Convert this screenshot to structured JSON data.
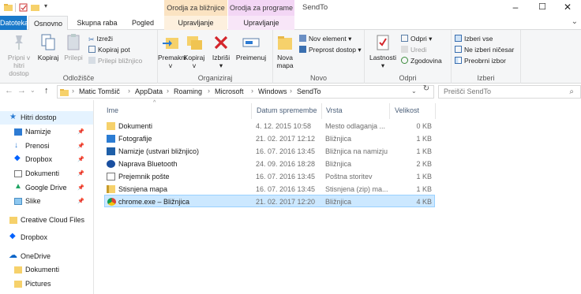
{
  "window": {
    "title": "SendTo",
    "context_tab_1": "Orodja za bližnjice",
    "context_tab_2": "Orodja za programe"
  },
  "ribbon_tabs": {
    "file": "Datoteka",
    "home": "Osnovno",
    "share": "Skupna raba",
    "view": "Pogled",
    "manage1": "Upravljanje",
    "manage2": "Upravljanje"
  },
  "ribbon": {
    "clipboard": {
      "label": "Odložišče",
      "pin": "Pripni v hitri\ndostop",
      "copy": "Kopiraj",
      "paste": "Prilepi",
      "cut": "Izreži",
      "copy_path": "Kopiraj pot",
      "paste_shortcut": "Prilepi bližnjico"
    },
    "organize": {
      "label": "Organiziraj",
      "move_to": "Premakni\nv",
      "copy_to": "Kopiraj\nv",
      "delete": "Izbriši",
      "rename": "Preimenuj"
    },
    "new": {
      "label": "Novo",
      "new_folder": "Nova\nmapa",
      "new_item": "Nov element",
      "easy_access": "Preprost dostop"
    },
    "open": {
      "label": "Odpri",
      "properties": "Lastnosti",
      "open": "Odpri",
      "edit": "Uredi",
      "history": "Zgodovina"
    },
    "select": {
      "label": "Izberi",
      "select_all": "Izberi vse",
      "select_none": "Ne izberi ničesar",
      "invert": "Preobrni izbor"
    }
  },
  "address": {
    "crumbs": [
      "Matic Tomšič",
      "AppData",
      "Roaming",
      "Microsoft",
      "Windows",
      "SendTo"
    ],
    "search_placeholder": "Preišči SendTo"
  },
  "nav": {
    "quick_access": "Hitri dostop",
    "pinned": [
      "Namizje",
      "Prenosi",
      "Dropbox",
      "Dokumenti",
      "Google Drive",
      "Slike"
    ],
    "creative_cloud": "Creative Cloud Files",
    "dropbox": "Dropbox",
    "onedrive": "OneDrive",
    "onedrive_children": [
      "Dokumenti",
      "Pictures"
    ]
  },
  "columns": {
    "name": "Ime",
    "date": "Datum spremembe",
    "type": "Vrsta",
    "size": "Velikost"
  },
  "files": [
    {
      "name": "Dokumenti",
      "date": "4. 12. 2015 10:58",
      "type": "Mesto odlaganja ...",
      "size": "0 KB",
      "icon": "folder-docs-icon"
    },
    {
      "name": "Fotografije",
      "date": "21. 02. 2017 12:12",
      "type": "Bližnjica",
      "size": "1 KB",
      "icon": "photos-icon"
    },
    {
      "name": "Namizje (ustvari bližnjico)",
      "date": "16. 07. 2016 13:45",
      "type": "Bližnjica na namizju",
      "size": "1 KB",
      "icon": "desktop-icon"
    },
    {
      "name": "Naprava Bluetooth",
      "date": "24. 09. 2016 18:28",
      "type": "Bližnjica",
      "size": "2 KB",
      "icon": "bluetooth-icon"
    },
    {
      "name": "Prejemnik pošte",
      "date": "16. 07. 2016 13:45",
      "type": "Poštna storitev",
      "size": "1 KB",
      "icon": "mail-icon"
    },
    {
      "name": "Stisnjena mapa",
      "date": "16. 07. 2016 13:45",
      "type": "Stisnjena (zip) ma...",
      "size": "1 KB",
      "icon": "zip-folder-icon"
    },
    {
      "name": "chrome.exe – Bližnjica",
      "date": "21. 02. 2017 12:20",
      "type": "Bližnjica",
      "size": "4 KB",
      "icon": "chrome-icon"
    }
  ]
}
